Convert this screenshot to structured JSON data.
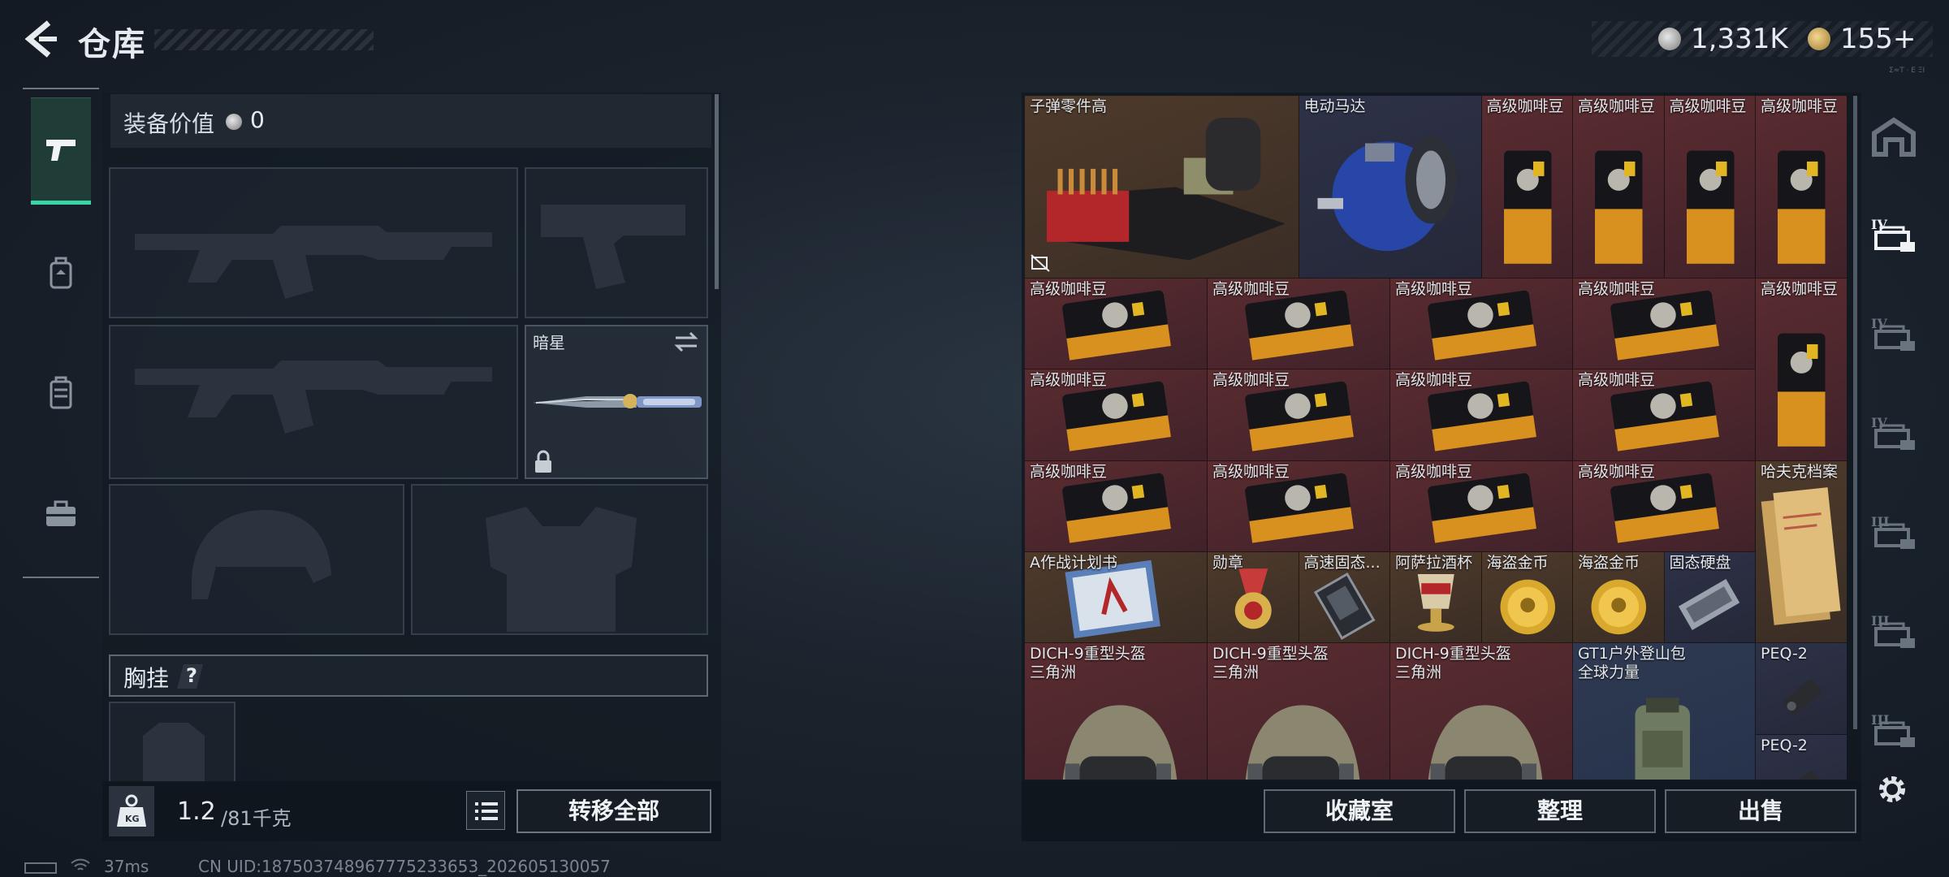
{
  "header": {
    "title": "仓库",
    "silver_amount": "1,331K",
    "gold_amount": "155+",
    "corner_note": "Σ≈Τ · Ε ΞΙ"
  },
  "loadout": {
    "equip_value_label": "装备价值",
    "equip_value_amount": "0",
    "melee_name": "暗星",
    "chest_rig_label": "胸挂",
    "chest_rig_help": "?",
    "weight_current": "1.2",
    "weight_max": "/81千克",
    "kg_label": "KG",
    "transfer_all": "转移全部"
  },
  "status": {
    "ping": "37ms",
    "uid": "CN UID:187503748967775233653_202605130057"
  },
  "storage": {
    "items": [
      {
        "label": "子弹零件高",
        "label2": "",
        "art": "ammo-crate",
        "color": "gold",
        "c": 0,
        "r": 0,
        "w": 3,
        "h": 2,
        "no_trade": true
      },
      {
        "label": "电动马达",
        "label2": "",
        "art": "motor",
        "color": "purple",
        "c": 3,
        "r": 0,
        "w": 2,
        "h": 2
      },
      {
        "label": "高级咖啡豆",
        "label2": "",
        "art": "coffee-upright",
        "color": "red",
        "c": 5,
        "r": 0,
        "w": 1,
        "h": 2
      },
      {
        "label": "高级咖啡豆",
        "label2": "",
        "art": "coffee-upright",
        "color": "red",
        "c": 6,
        "r": 0,
        "w": 1,
        "h": 2
      },
      {
        "label": "高级咖啡豆",
        "label2": "",
        "art": "coffee-upright",
        "color": "red",
        "c": 7,
        "r": 0,
        "w": 1,
        "h": 2
      },
      {
        "label": "高级咖啡豆",
        "label2": "",
        "art": "coffee-upright",
        "color": "red",
        "c": 8,
        "r": 0,
        "w": 1,
        "h": 2
      },
      {
        "label": "高级咖啡豆",
        "label2": "",
        "art": "coffee-flat",
        "color": "red",
        "c": 0,
        "r": 2,
        "w": 2,
        "h": 1
      },
      {
        "label": "高级咖啡豆",
        "label2": "",
        "art": "coffee-flat",
        "color": "red",
        "c": 2,
        "r": 2,
        "w": 2,
        "h": 1
      },
      {
        "label": "高级咖啡豆",
        "label2": "",
        "art": "coffee-flat",
        "color": "red",
        "c": 4,
        "r": 2,
        "w": 2,
        "h": 1
      },
      {
        "label": "高级咖啡豆",
        "label2": "",
        "art": "coffee-flat",
        "color": "red",
        "c": 6,
        "r": 2,
        "w": 2,
        "h": 1
      },
      {
        "label": "高级咖啡豆",
        "label2": "",
        "art": "coffee-upright",
        "color": "red",
        "c": 8,
        "r": 2,
        "w": 1,
        "h": 2
      },
      {
        "label": "高级咖啡豆",
        "label2": "",
        "art": "coffee-flat",
        "color": "red",
        "c": 0,
        "r": 3,
        "w": 2,
        "h": 1
      },
      {
        "label": "高级咖啡豆",
        "label2": "",
        "art": "coffee-flat",
        "color": "red",
        "c": 2,
        "r": 3,
        "w": 2,
        "h": 1
      },
      {
        "label": "高级咖啡豆",
        "label2": "",
        "art": "coffee-flat",
        "color": "red",
        "c": 4,
        "r": 3,
        "w": 2,
        "h": 1
      },
      {
        "label": "高级咖啡豆",
        "label2": "",
        "art": "coffee-flat",
        "color": "red",
        "c": 6,
        "r": 3,
        "w": 2,
        "h": 1
      },
      {
        "label": "高级咖啡豆",
        "label2": "",
        "art": "coffee-flat",
        "color": "red",
        "c": 0,
        "r": 4,
        "w": 2,
        "h": 1
      },
      {
        "label": "高级咖啡豆",
        "label2": "",
        "art": "coffee-flat",
        "color": "red",
        "c": 2,
        "r": 4,
        "w": 2,
        "h": 1
      },
      {
        "label": "高级咖啡豆",
        "label2": "",
        "art": "coffee-flat",
        "color": "red",
        "c": 4,
        "r": 4,
        "w": 2,
        "h": 1
      },
      {
        "label": "高级咖啡豆",
        "label2": "",
        "art": "coffee-flat",
        "color": "red",
        "c": 6,
        "r": 4,
        "w": 2,
        "h": 1
      },
      {
        "label": "哈夫克档案",
        "label2": "",
        "art": "dossier",
        "color": "gold",
        "c": 8,
        "r": 4,
        "w": 1,
        "h": 2
      },
      {
        "label": "A作战计划书",
        "label2": "",
        "art": "plan-book",
        "color": "gold",
        "c": 0,
        "r": 5,
        "w": 2,
        "h": 1
      },
      {
        "label": "勋章",
        "label2": "",
        "art": "medal",
        "color": "gold",
        "c": 2,
        "r": 5,
        "w": 1,
        "h": 1
      },
      {
        "label": "高速固态...",
        "label2": "",
        "art": "ssd",
        "color": "gold",
        "c": 3,
        "r": 5,
        "w": 1,
        "h": 1
      },
      {
        "label": "阿萨拉酒杯",
        "label2": "",
        "art": "goblet",
        "color": "gold",
        "c": 4,
        "r": 5,
        "w": 1,
        "h": 1
      },
      {
        "label": "海盗金币",
        "label2": "",
        "art": "gold-coin",
        "color": "gold",
        "c": 5,
        "r": 5,
        "w": 1,
        "h": 1
      },
      {
        "label": "海盗金币",
        "label2": "",
        "art": "gold-coin",
        "color": "gold",
        "c": 6,
        "r": 5,
        "w": 1,
        "h": 1
      },
      {
        "label": "固态硬盘",
        "label2": "",
        "art": "hdd",
        "color": "purple",
        "c": 7,
        "r": 5,
        "w": 1,
        "h": 1
      },
      {
        "label": "DICH-9重型头盔",
        "label2": "三角洲",
        "art": "helmet",
        "color": "red",
        "c": 0,
        "r": 6,
        "w": 2,
        "h": 2
      },
      {
        "label": "DICH-9重型头盔",
        "label2": "三角洲",
        "art": "helmet",
        "color": "red",
        "c": 2,
        "r": 6,
        "w": 2,
        "h": 2
      },
      {
        "label": "DICH-9重型头盔",
        "label2": "三角洲",
        "art": "helmet",
        "color": "red",
        "c": 4,
        "r": 6,
        "w": 2,
        "h": 2
      },
      {
        "label": "GT1户外登山包",
        "label2": "全球力量",
        "art": "backpack",
        "color": "blue",
        "c": 6,
        "r": 6,
        "w": 2,
        "h": 2
      },
      {
        "label": "PEQ-2",
        "label2": "",
        "art": "peq",
        "color": "purple",
        "c": 8,
        "r": 6,
        "w": 1,
        "h": 1
      },
      {
        "label": "PEQ-2",
        "label2": "",
        "art": "peq",
        "color": "purple",
        "c": 8,
        "r": 7,
        "w": 1,
        "h": 1
      }
    ],
    "actions": {
      "collection": "收藏室",
      "organize": "整理",
      "sell": "出售"
    }
  },
  "sidebar_right": {
    "tabs": [
      {
        "icon": "safehouse-icon",
        "active": false
      },
      {
        "icon": "container-iv-icon",
        "active": true
      },
      {
        "icon": "container-iv-icon",
        "active": false
      },
      {
        "icon": "container-iv-icon",
        "active": false
      },
      {
        "icon": "container-iii-icon",
        "active": false
      },
      {
        "icon": "container-iii-icon",
        "active": false
      },
      {
        "icon": "container-iii-icon",
        "active": false
      }
    ]
  },
  "colors": {
    "accent_green": "#38d6a5",
    "rarity_red": "#5a2c30",
    "rarity_gold": "#4e3a2b",
    "rarity_purple": "#2e3248",
    "rarity_blue": "#2f3a52"
  }
}
